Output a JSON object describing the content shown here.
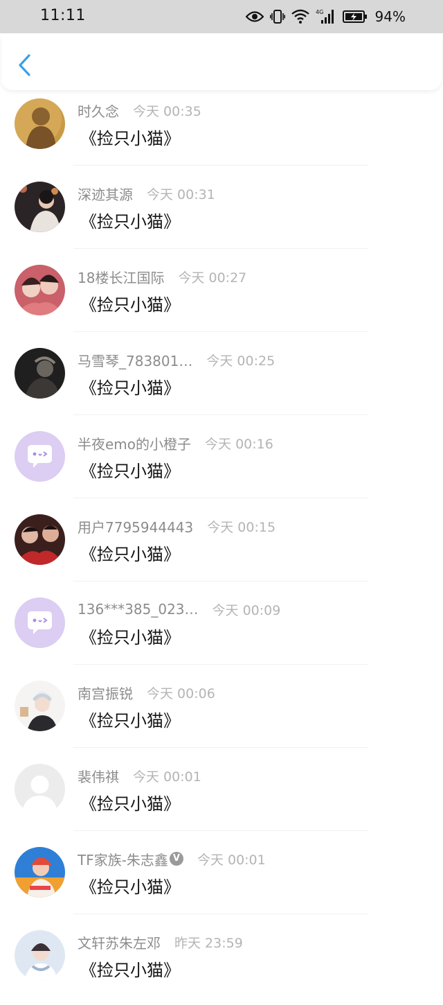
{
  "status_bar": {
    "time": "11:11",
    "network": "4G",
    "battery_percent": "94%",
    "icons": [
      "eye-icon",
      "vibrate-icon",
      "wifi-icon",
      "signal-icon",
      "battery-icon"
    ]
  },
  "header": {
    "back_icon": "chevron-left-icon",
    "accent_color": "#3aa0e8"
  },
  "comments": [
    {
      "user": "时久念",
      "time": "今天 00:35",
      "text": "《捡只小猫》",
      "avatar": "photo-gold"
    },
    {
      "user": "深迹其源",
      "time": "今天 00:31",
      "text": "《捡只小猫》",
      "avatar": "photo-dark"
    },
    {
      "user": "18楼长江国际",
      "time": "今天 00:27",
      "text": "《捡只小猫》",
      "avatar": "photo-pink"
    },
    {
      "user": "马雪琴_783801…",
      "time": "今天 00:25",
      "text": "《捡只小猫》",
      "avatar": "photo-black"
    },
    {
      "user": "半夜emo的小橙子",
      "time": "今天 00:16",
      "text": "《捡只小猫》",
      "avatar": "default-chat-purple"
    },
    {
      "user": "用户7795944443",
      "time": "今天 00:15",
      "text": "《捡只小猫》",
      "avatar": "photo-red"
    },
    {
      "user": "136***385_023…",
      "time": "今天 00:09",
      "text": "《捡只小猫》",
      "avatar": "default-chat-purple"
    },
    {
      "user": "南宫振锐",
      "time": "今天 00:06",
      "text": "《捡只小猫》",
      "avatar": "illustration-white-hair"
    },
    {
      "user": "裴伟祺",
      "time": "今天 00:01",
      "text": "《捡只小猫》",
      "avatar": "default-gray"
    },
    {
      "user": "TF家族-朱志鑫",
      "verified": "V",
      "time": "今天 00:01",
      "text": "《捡只小猫》",
      "avatar": "photo-colorful"
    },
    {
      "user": "文轩苏朱左邓",
      "time": "昨天 23:59",
      "text": "《捡只小猫》",
      "avatar": "photo-light"
    }
  ]
}
